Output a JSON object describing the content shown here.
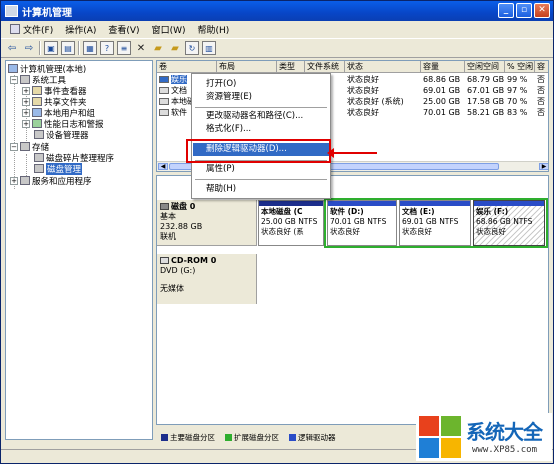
{
  "window": {
    "title": "计算机管理"
  },
  "menu": [
    "文件(F)",
    "操作(A)",
    "查看(V)",
    "窗口(W)",
    "帮助(H)"
  ],
  "toolbar_icons": [
    "back-icon",
    "forward-icon",
    "up-icon",
    "show-tree-icon",
    "properties-icon",
    "help-icon",
    "list-icon",
    "delete-icon",
    "open-icon",
    "export-icon",
    "refresh-icon",
    "view-icon"
  ],
  "tree": {
    "root": "计算机管理(本地)",
    "system_tools": "系统工具",
    "event_viewer": "事件查看器",
    "shared_folders": "共享文件夹",
    "local_users": "本地用户和组",
    "perf_logs": "性能日志和警报",
    "device_manager": "设备管理器",
    "storage": "存储",
    "defrag": "磁盘碎片整理程序",
    "disk_mgmt": "磁盘管理",
    "services": "服务和应用程序"
  },
  "list": {
    "headers": [
      "卷",
      "布局",
      "类型",
      "文件系统",
      "状态",
      "容量",
      "空闲空间",
      "% 空闲",
      "容"
    ],
    "rows": [
      {
        "name": "娱乐",
        "status": "状态良好",
        "capacity": "68.86 GB",
        "free": "68.79 GB",
        "pct": "99 %",
        "extra": "否"
      },
      {
        "name": "文档",
        "status": "状态良好",
        "capacity": "69.01 GB",
        "free": "67.01 GB",
        "pct": "97 %",
        "extra": "否"
      },
      {
        "name": "本地磁",
        "status": "状态良好 (系统)",
        "capacity": "25.00 GB",
        "free": "17.58 GB",
        "pct": "70 %",
        "extra": "否"
      },
      {
        "name": "软件",
        "status": "状态良好",
        "capacity": "70.01 GB",
        "free": "58.21 GB",
        "pct": "83 %",
        "extra": "否"
      }
    ]
  },
  "context_menu": {
    "open": "打开(O)",
    "explore": "资源管理(E)",
    "change_letter": "更改驱动器名和路径(C)...",
    "format": "格式化(F)...",
    "delete_logical": "删除逻辑驱动器(D)...",
    "properties": "属性(P)",
    "help": "帮助(H)"
  },
  "disk0": {
    "name": "磁盘 0",
    "type": "基本",
    "size": "232.88 GB",
    "status": "联机",
    "partitions": [
      {
        "title": "本地磁盘 (C",
        "size": "25.00 GB NTFS",
        "status": "状态良好 (系"
      },
      {
        "title": "软件 (D:)",
        "size": "70.01 GB NTFS",
        "status": "状态良好"
      },
      {
        "title": "文档 (E:)",
        "size": "69.01 GB NTFS",
        "status": "状态良好"
      },
      {
        "title": "娱乐 (F:)",
        "size": "68.86 GB NTFS",
        "status": "状态良好"
      }
    ]
  },
  "cdrom": {
    "name": "CD-ROM 0",
    "type": "DVD (G:)",
    "status": "无媒体"
  },
  "legend": [
    "主要磁盘分区",
    "扩展磁盘分区",
    "逻辑驱动器"
  ],
  "colors": {
    "primary": "#1c2e8c",
    "extended": "#2eae2e",
    "logical": "#2a4cc7",
    "highlight": "#316ac5",
    "annotation": "#e00000"
  },
  "watermark": {
    "title": "系统大全",
    "url": "www.XP85.com"
  }
}
